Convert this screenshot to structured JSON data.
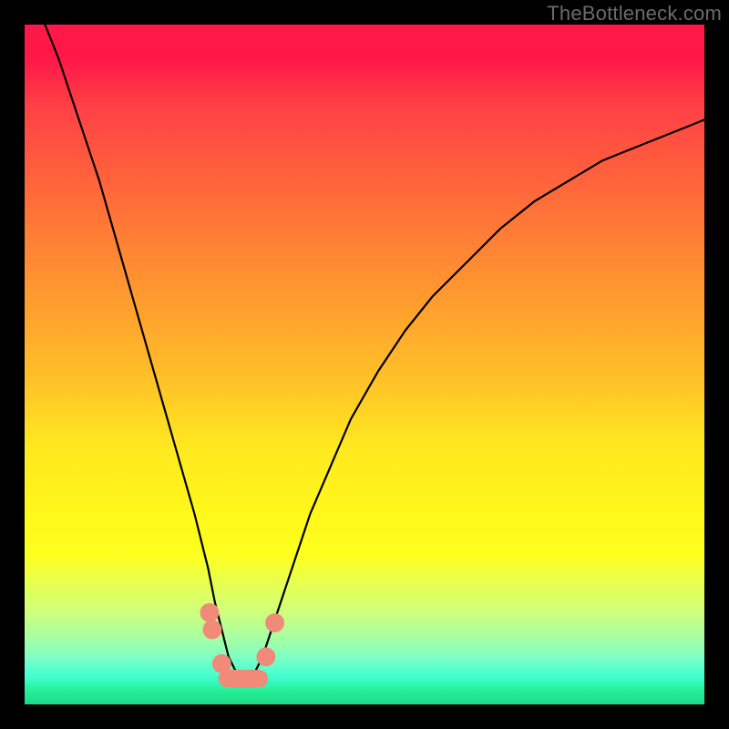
{
  "watermark": "TheBottleneck.com",
  "chart_data": {
    "type": "line",
    "title": "",
    "xlabel": "",
    "ylabel": "",
    "xlim": [
      0,
      100
    ],
    "ylim": [
      0,
      100
    ],
    "grid": false,
    "series": [
      {
        "name": "bottleneck-curve",
        "color": "#000000",
        "x": [
          3,
          5,
          7,
          9,
          11,
          13,
          15,
          17,
          19,
          21,
          23,
          25,
          27,
          28,
          29,
          30,
          31,
          32,
          33,
          34,
          35,
          36,
          38,
          40,
          42,
          45,
          48,
          52,
          56,
          60,
          65,
          70,
          75,
          80,
          85,
          90,
          95,
          100
        ],
        "y": [
          100,
          95,
          89,
          83,
          77,
          70,
          63,
          56,
          49,
          42,
          35,
          28,
          20,
          15,
          11,
          7,
          5,
          4,
          4,
          5,
          7,
          10,
          16,
          22,
          28,
          35,
          42,
          49,
          55,
          60,
          65,
          70,
          74,
          77,
          80,
          82,
          84,
          86
        ]
      }
    ],
    "markers": [
      {
        "name": "left-upper-dot",
        "x": 27.2,
        "y": 13.5,
        "r": 1.4,
        "color": "#f28a7a"
      },
      {
        "name": "left-lower-dot",
        "x": 27.6,
        "y": 11.0,
        "r": 1.4,
        "color": "#f28a7a"
      },
      {
        "name": "left-base-dot",
        "x": 29.0,
        "y": 6.0,
        "r": 1.4,
        "color": "#f28a7a"
      },
      {
        "name": "right-base-dot",
        "x": 35.5,
        "y": 7.0,
        "r": 1.4,
        "color": "#f28a7a"
      },
      {
        "name": "right-upper-dot",
        "x": 36.8,
        "y": 12.0,
        "r": 1.4,
        "color": "#f28a7a"
      }
    ],
    "minimum_band": {
      "name": "trough-band",
      "x_start": 29.8,
      "x_end": 34.5,
      "y": 3.8,
      "thickness": 2.6,
      "color": "#f28a7a"
    },
    "background_gradient": {
      "top": "#ff1848",
      "mid": "#fff81a",
      "bottom": "#1fd888"
    }
  }
}
